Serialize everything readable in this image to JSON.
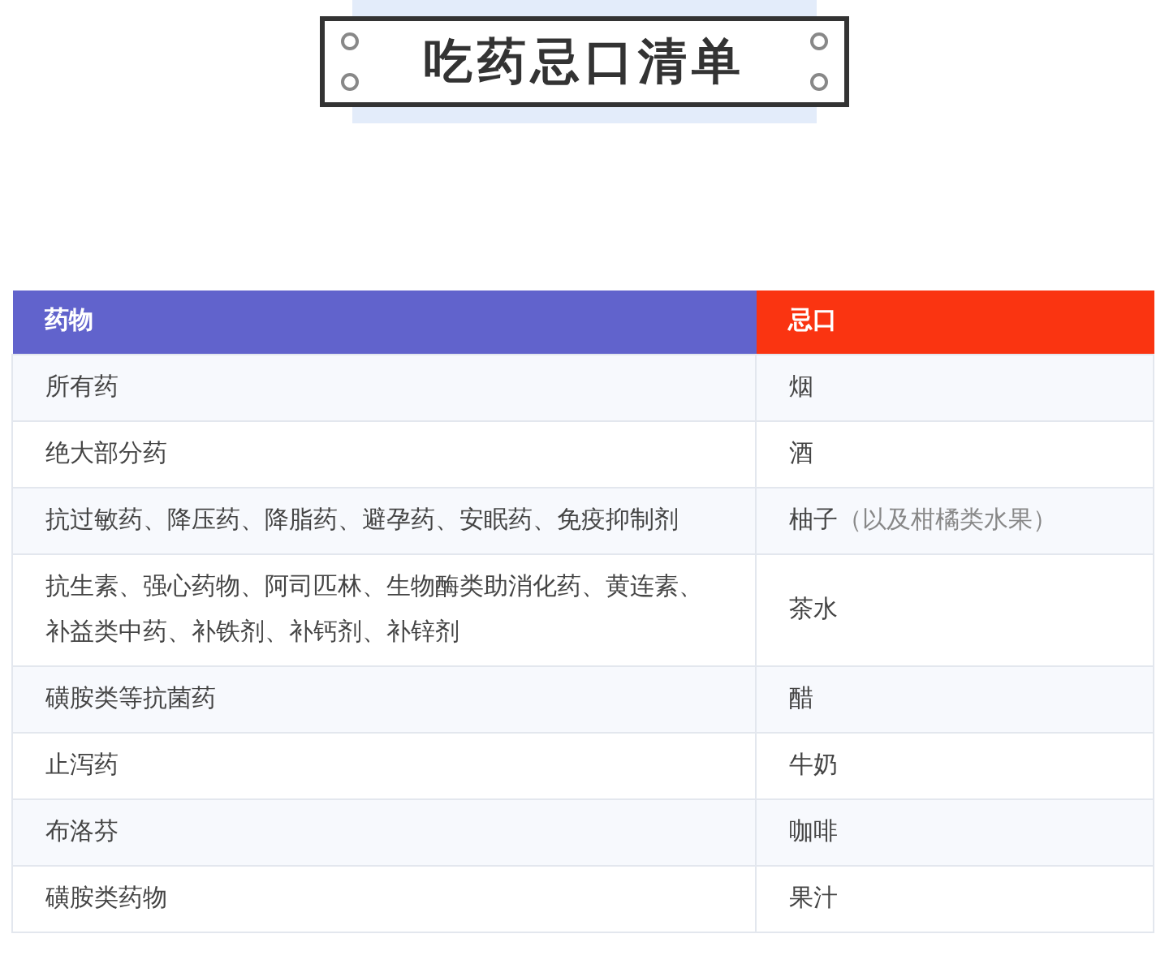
{
  "title": "吃药忌口清单",
  "table": {
    "columns": [
      {
        "label": "药物",
        "color": "#6163cc"
      },
      {
        "label": "忌口",
        "color": "#fa3411"
      }
    ],
    "rows": [
      {
        "drug": "所有药",
        "avoid": "烟"
      },
      {
        "drug": "绝大部分药",
        "avoid": "酒"
      },
      {
        "drug": "抗过敏药、降压药、降脂药、避孕药、安眠药、免疫抑制剂",
        "avoid": "柚子",
        "note": "（以及柑橘类水果）"
      },
      {
        "drug": "抗生素、强心药物、阿司匹林、生物酶类助消化药、黄连素、补益类中药、补铁剂、补钙剂、补锌剂",
        "avoid": "茶水"
      },
      {
        "drug": "磺胺类等抗菌药",
        "avoid": "醋"
      },
      {
        "drug": "止泻药",
        "avoid": "牛奶"
      },
      {
        "drug": "布洛芬",
        "avoid": "咖啡"
      },
      {
        "drug": "磺胺类药物",
        "avoid": "果汁"
      }
    ]
  }
}
